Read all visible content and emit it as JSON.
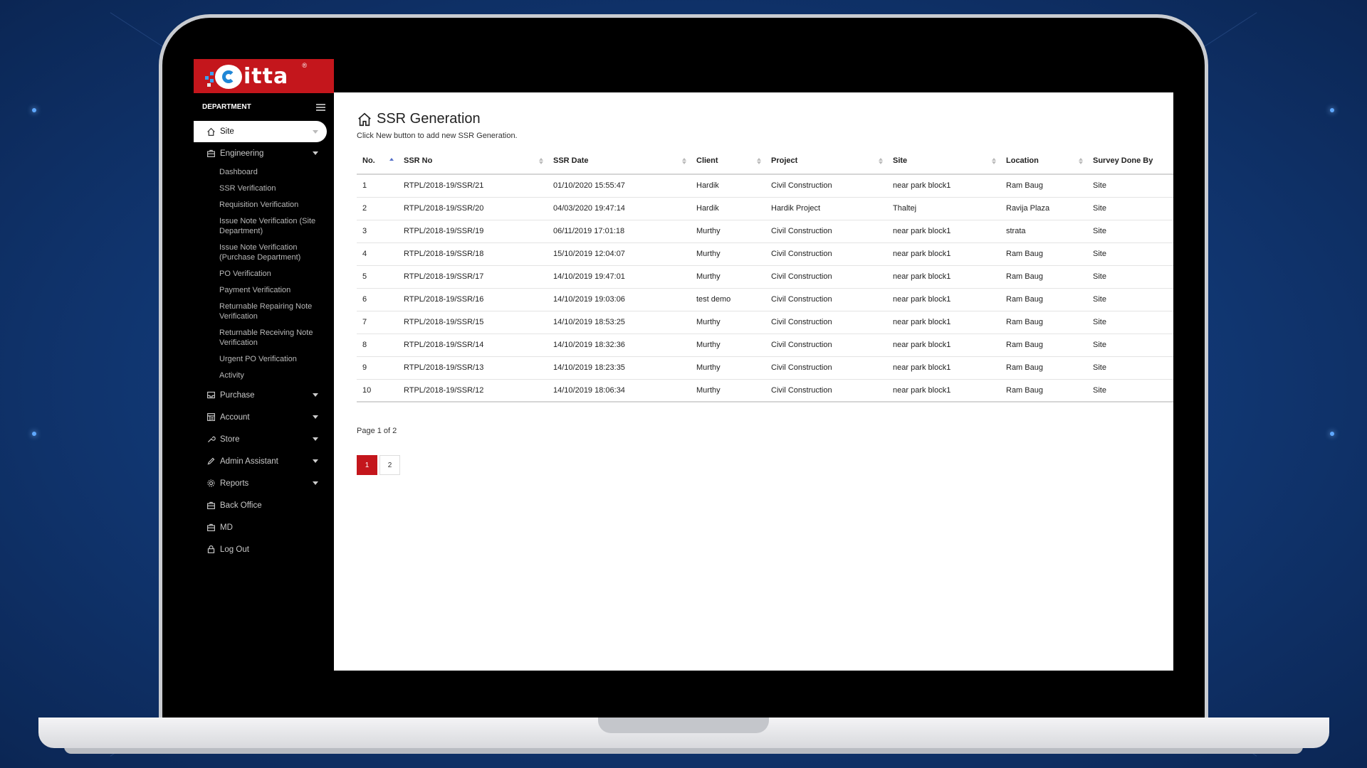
{
  "theme": {
    "brand_red": "#c4161c",
    "sidebar_bg": "#000000",
    "accent_blue": "#5570c8"
  },
  "logo": {
    "text": "itta",
    "reg": "®"
  },
  "sidebar": {
    "section_label": "DEPARTMENT",
    "items": [
      {
        "label": "Site",
        "icon": "home-icon"
      },
      {
        "label": "Engineering",
        "icon": "briefcase-icon"
      },
      {
        "label": "Purchase",
        "icon": "inbox-icon"
      },
      {
        "label": "Account",
        "icon": "ledger-icon"
      },
      {
        "label": "Store",
        "icon": "wrench-icon"
      },
      {
        "label": "Admin Assistant",
        "icon": "pencil-icon"
      },
      {
        "label": "Reports",
        "icon": "gear-icon"
      },
      {
        "label": "Back Office",
        "icon": "briefcase-icon"
      },
      {
        "label": "MD",
        "icon": "briefcase-icon"
      },
      {
        "label": "Log Out",
        "icon": "lock-icon"
      }
    ],
    "engineering_sub": [
      "Dashboard",
      "SSR Verification",
      "Requisition Verification",
      "Issue Note Verification (Site Department)",
      "Issue Note Verification (Purchase Department)",
      "PO Verification",
      "Payment Verification",
      "Returnable Repairing Note Verification",
      "Returnable Receiving Note Verification",
      "Urgent PO Verification",
      "Activity"
    ]
  },
  "main": {
    "title": "SSR Generation",
    "subtitle": "Click New button to add new SSR Generation.",
    "columns": [
      "No.",
      "SSR No",
      "SSR Date",
      "Client",
      "Project",
      "Site",
      "Location",
      "Survey Done By"
    ],
    "rows": [
      [
        "1",
        "RTPL/2018-19/SSR/21",
        "01/10/2020 15:55:47",
        "Hardik",
        "Civil Construction",
        "near park block1",
        "Ram Baug",
        "Site"
      ],
      [
        "2",
        "RTPL/2018-19/SSR/20",
        "04/03/2020 19:47:14",
        "Hardik",
        "Hardik Project",
        "Thaltej",
        "Ravija Plaza",
        "Site"
      ],
      [
        "3",
        "RTPL/2018-19/SSR/19",
        "06/11/2019 17:01:18",
        "Murthy",
        "Civil Construction",
        "near park block1",
        "strata",
        "Site"
      ],
      [
        "4",
        "RTPL/2018-19/SSR/18",
        "15/10/2019 12:04:07",
        "Murthy",
        "Civil Construction",
        "near park block1",
        "Ram Baug",
        "Site"
      ],
      [
        "5",
        "RTPL/2018-19/SSR/17",
        "14/10/2019 19:47:01",
        "Murthy",
        "Civil Construction",
        "near park block1",
        "Ram Baug",
        "Site"
      ],
      [
        "6",
        "RTPL/2018-19/SSR/16",
        "14/10/2019 19:03:06",
        "test demo",
        "Civil Construction",
        "near park block1",
        "Ram Baug",
        "Site"
      ],
      [
        "7",
        "RTPL/2018-19/SSR/15",
        "14/10/2019 18:53:25",
        "Murthy",
        "Civil Construction",
        "near park block1",
        "Ram Baug",
        "Site"
      ],
      [
        "8",
        "RTPL/2018-19/SSR/14",
        "14/10/2019 18:32:36",
        "Murthy",
        "Civil Construction",
        "near park block1",
        "Ram Baug",
        "Site"
      ],
      [
        "9",
        "RTPL/2018-19/SSR/13",
        "14/10/2019 18:23:35",
        "Murthy",
        "Civil Construction",
        "near park block1",
        "Ram Baug",
        "Site"
      ],
      [
        "10",
        "RTPL/2018-19/SSR/12",
        "14/10/2019 18:06:34",
        "Murthy",
        "Civil Construction",
        "near park block1",
        "Ram Baug",
        "Site"
      ]
    ],
    "page_info": "Page 1 of 2",
    "pages": [
      "1",
      "2"
    ]
  }
}
